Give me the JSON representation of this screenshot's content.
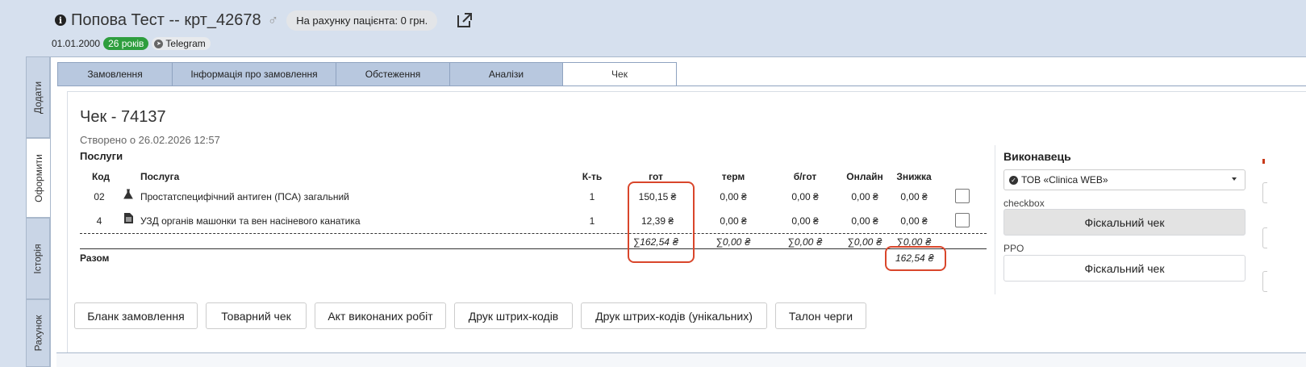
{
  "header": {
    "patient_name": "Попова Тест -- крт_42678",
    "gender_symbol": "♂",
    "balance_label": "На рахунку пацієнта: 0 грн.",
    "birth_date": "01.01.2000",
    "age_badge": "26 років",
    "telegram_label": "Telegram",
    "icons": [
      "info-icon",
      "male-icon",
      "external-link-icon",
      "telegram-icon"
    ]
  },
  "side_tabs": [
    {
      "label": "Додати",
      "active": false
    },
    {
      "label": "Оформити",
      "active": true
    },
    {
      "label": "Історія",
      "active": false
    },
    {
      "label": "Рахунок",
      "active": false
    }
  ],
  "tabs": [
    {
      "label": "Замовлення",
      "active": false
    },
    {
      "label": "Інформація про замовлення",
      "active": false
    },
    {
      "label": "Обстеження",
      "active": false
    },
    {
      "label": "Аналізи",
      "active": false
    },
    {
      "label": "Чек",
      "active": true
    }
  ],
  "receipt": {
    "title": "Чек - 74137",
    "created": "Створено о 26.02.2026 12:57",
    "services_heading": "Послуги",
    "columns": {
      "code": "Код",
      "service": "Послуга",
      "qty": "К-ть",
      "cash": "гот",
      "terminal": "терм",
      "cashless": "б/гот",
      "online": "Онлайн",
      "discount": "Знижка"
    },
    "rows": [
      {
        "code": "02",
        "icon": "flask-icon",
        "service": "Простатспецифічний антиген (ПСА) загальний",
        "qty": "1",
        "cash": "150,15 ₴",
        "terminal": "0,00 ₴",
        "cashless": "0,00 ₴",
        "online": "0,00 ₴",
        "discount": "0,00 ₴",
        "checked": false
      },
      {
        "code": "4",
        "icon": "document-icon",
        "service": "УЗД органів машонки та вен насіневого канатика",
        "qty": "1",
        "cash": "12,39 ₴",
        "terminal": "0,00 ₴",
        "cashless": "0,00 ₴",
        "online": "0,00 ₴",
        "discount": "0,00 ₴",
        "checked": false
      }
    ],
    "sums": {
      "cash": "∑162,54 ₴",
      "terminal": "∑0,00 ₴",
      "cashless": "∑0,00 ₴",
      "online": "∑0,00 ₴",
      "discount": "∑0,00 ₴"
    },
    "total_label": "Разом",
    "total_value": "162,54 ₴"
  },
  "executor": {
    "heading": "Виконавець",
    "selected": "ТОВ «Clinica WEB»",
    "checkbox_label": "checkbox",
    "fiscal_button_1": "Фіскальний чек",
    "ppo_label": "PPO",
    "fiscal_button_2": "Фіскальний чек"
  },
  "bottom_buttons": [
    "Бланк замовлення",
    "Товарний чек",
    "Акт виконаних робіт",
    "Друк штрих-кодів",
    "Друк штрих-кодів (унікальних)",
    "Талон черги"
  ],
  "colors": {
    "background": "#d6e0ee",
    "tab_inactive": "#b8c8df",
    "age_badge": "#2e9e3e",
    "highlight_box": "#d9462b"
  }
}
